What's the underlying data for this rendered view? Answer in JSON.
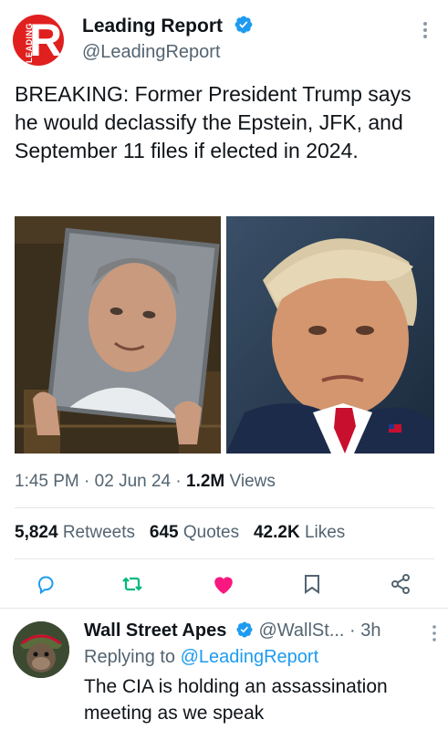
{
  "tweet": {
    "author_name": "Leading Report",
    "handle": "@LeadingReport",
    "avatar_letter": "R",
    "avatar_text": "LEADING",
    "text": "BREAKING: Former President Trump says he would declassify the Epstein, JFK, and September 11 files if elected in 2024.",
    "time": "1:45 PM",
    "date": "02 Jun 24",
    "views_count": "1.2M",
    "views_label": "Views",
    "retweets_count": "5,824",
    "retweets_label": "Retweets",
    "quotes_count": "645",
    "quotes_label": "Quotes",
    "likes_count": "42.2K",
    "likes_label": "Likes",
    "liked": true
  },
  "reply": {
    "author_name": "Wall Street Apes",
    "handle": "@WallSt...",
    "time": "3h",
    "replying_prefix": "Replying to",
    "replying_to": "@LeadingReport",
    "text": "The CIA is holding an assassination meeting as we speak"
  },
  "colors": {
    "accent": "#1d9bf0",
    "like": "#f91880",
    "retweet": "#00ba7c",
    "secondary_text": "#536471",
    "avatar_red": "#e0201f"
  },
  "icons": [
    "verified-badge-icon",
    "more-options-icon",
    "reply-icon",
    "retweet-icon",
    "like-icon",
    "bookmark-icon",
    "share-icon"
  ]
}
